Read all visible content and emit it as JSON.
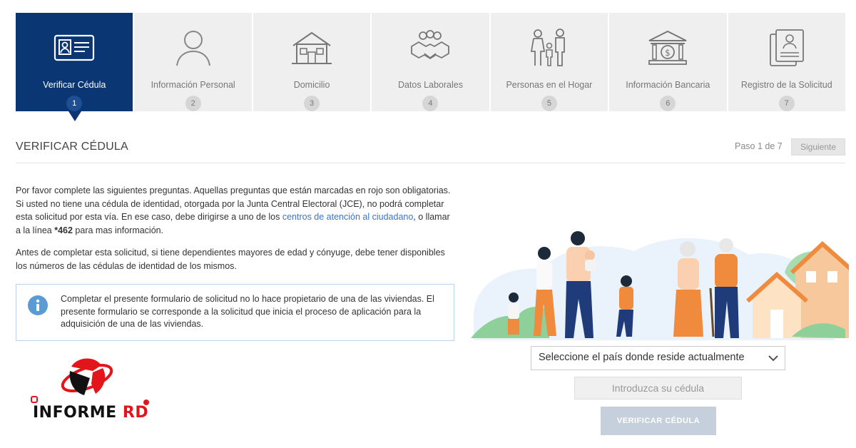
{
  "steps": [
    {
      "label": "Verificar Cédula",
      "num": "1",
      "icon": "id-card-icon"
    },
    {
      "label": "Información Personal",
      "num": "2",
      "icon": "person-icon"
    },
    {
      "label": "Domicilio",
      "num": "3",
      "icon": "house-icon"
    },
    {
      "label": "Datos Laborales",
      "num": "4",
      "icon": "handshake-icon"
    },
    {
      "label": "Personas en el Hogar",
      "num": "5",
      "icon": "family-icon"
    },
    {
      "label": "Información Bancaria",
      "num": "6",
      "icon": "bank-icon"
    },
    {
      "label": "Registro de la Solicitud",
      "num": "7",
      "icon": "document-icon"
    }
  ],
  "header": {
    "title": "VERIFICAR CÉDULA",
    "step_text": "Paso 1 de 7",
    "next_label": "Siguiente"
  },
  "intro": {
    "p1_a": "Por favor complete las siguientes preguntas. Aquellas preguntas que están marcadas en rojo son obligatorias. Si usted no tiene una cédula de identidad, otorgada por la Junta Central Electoral (JCE), no podrá completar esta solicitud por esta vía. En ese caso, debe dirigirse a uno de los ",
    "p1_link": "centros de atención al ciudadano",
    "p1_b": ", o llamar a la línea ",
    "p1_phone": "*462",
    "p1_c": " para mas información.",
    "p2": "Antes de completar esta solicitud, si tiene dependientes mayores de edad y cónyuge, debe tener disponibles los números de las cédulas de identidad de los mismos."
  },
  "alert": {
    "text": "Completar el presente formulario de solicitud no lo hace propietario de una de las viviendas. El presente formulario se corresponde a la solicitud que inicia el proceso de aplicación para la adquisición de una de las viviendas."
  },
  "form": {
    "country_select": "Seleccione el país donde reside actualmente",
    "cedula_placeholder": "Introduzca su cédula",
    "verify_label": "VERIFICAR CÉDULA"
  },
  "logo": {
    "text_a": "INFORME",
    "text_b": "RD"
  },
  "colors": {
    "active_step": "#0b3674",
    "link": "#3a73c9",
    "alert_border": "#bcd3ec",
    "logo_red": "#e3151a"
  }
}
